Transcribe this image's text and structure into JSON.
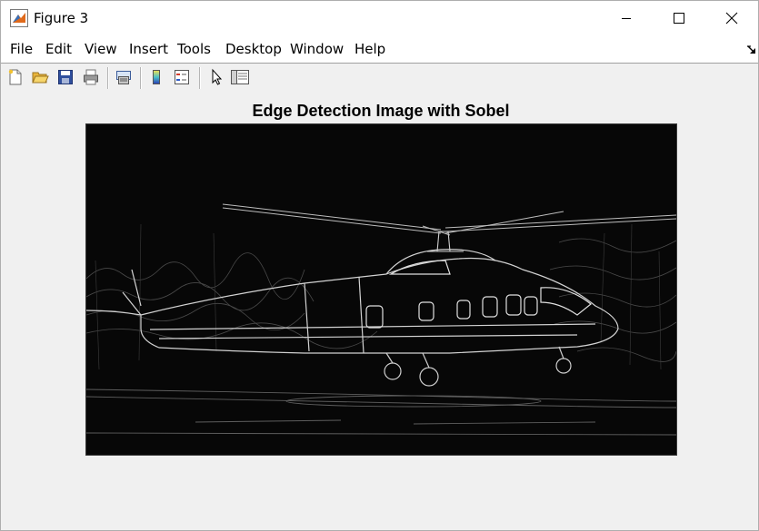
{
  "window": {
    "title": "Figure 3",
    "app_icon": "matlab-figure-icon",
    "controls": [
      "minimize-icon",
      "maximize-icon",
      "close-icon"
    ]
  },
  "menu": {
    "items": [
      "File",
      "Edit",
      "View",
      "Insert",
      "Tools",
      "Desktop",
      "Window",
      "Help"
    ],
    "dock_icon": "dock-arrow-icon"
  },
  "toolbar": {
    "buttons": [
      {
        "name": "new-figure-icon"
      },
      {
        "name": "open-file-icon"
      },
      {
        "name": "save-icon"
      },
      {
        "name": "print-icon"
      },
      {
        "name": "link-plot-icon"
      },
      {
        "name": "insert-colorbar-icon"
      },
      {
        "name": "insert-legend-icon"
      },
      {
        "name": "edit-plot-pointer-icon"
      },
      {
        "name": "plot-tools-icon"
      }
    ]
  },
  "figure": {
    "axes_title": "Edge Detection Image with Sobel",
    "image_description_icon": "edge-detected-helicopter-image"
  },
  "colors": {
    "image_background": "#070707",
    "edge_color": "#cfcfcf",
    "window_background": "#f0f0f0"
  }
}
